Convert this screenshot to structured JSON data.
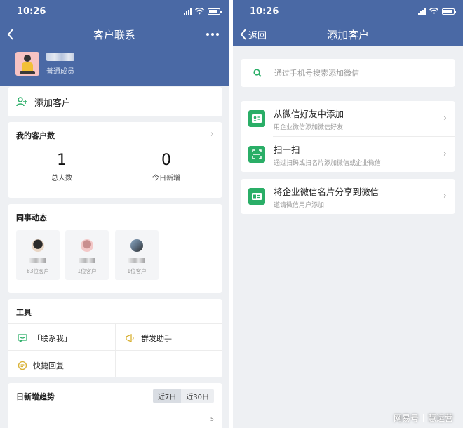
{
  "status_time": "10:26",
  "colors": {
    "header": "#4a69a5",
    "green": "#2aae67",
    "background": "#eef0f3"
  },
  "left": {
    "title": "客户联系",
    "profile": {
      "role": "普通成员"
    },
    "add_customer": "添加客户",
    "customer_count": {
      "title": "我的客户数",
      "total": {
        "value": "1",
        "label": "总人数"
      },
      "today": {
        "value": "0",
        "label": "今日新增"
      }
    },
    "colleagues": {
      "title": "同事动态",
      "items": [
        {
          "count": "83位客户"
        },
        {
          "count": "1位客户"
        },
        {
          "count": "1位客户"
        }
      ]
    },
    "tools": {
      "title": "工具",
      "contact_me": "「联系我」",
      "mass_send": "群发助手",
      "quick_reply": "快捷回复"
    },
    "trend": {
      "title": "日新增趋势",
      "tab_7": "近7日",
      "tab_30": "近30日",
      "axis_tick": "5"
    }
  },
  "right": {
    "back": "返回",
    "title": "添加客户",
    "search_placeholder": "通过手机号搜索添加微信",
    "options": [
      {
        "title": "从微信好友中添加",
        "sub": "用企业微信添加微信好友"
      },
      {
        "title": "扫一扫",
        "sub": "通过扫码或扫名片添加微信或企业微信"
      },
      {
        "title": "将企业微信名片分享到微信",
        "sub": "邀请微信用户添加"
      }
    ]
  },
  "watermark": {
    "source": "网易号",
    "author": "慧运营"
  }
}
